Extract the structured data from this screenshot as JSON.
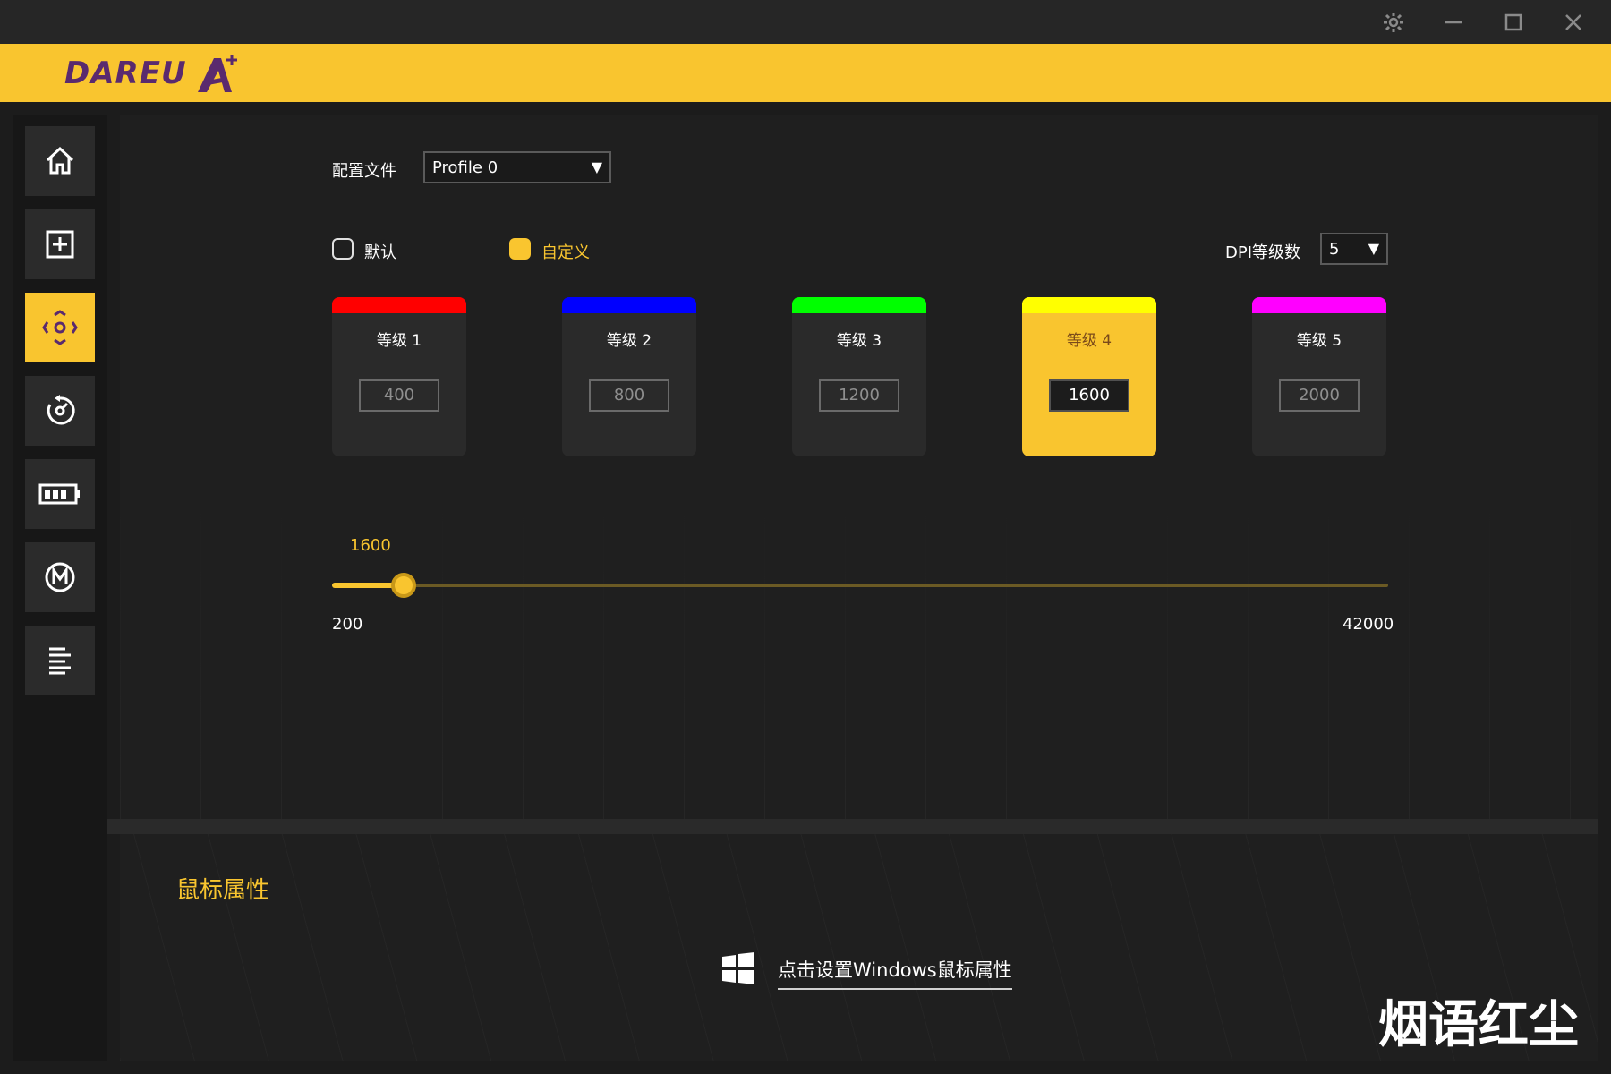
{
  "window": {
    "controls": [
      "settings-icon",
      "minimize-icon",
      "maximize-icon",
      "close-icon"
    ]
  },
  "brand": {
    "logo_text": "DAREU",
    "accent_color": "#f9c52f",
    "logo_color": "#5a2a6e"
  },
  "sidebar": {
    "items": [
      {
        "icon": "home-icon",
        "active": false
      },
      {
        "icon": "plus-square-icon",
        "active": false
      },
      {
        "icon": "dpi-crosshair-icon",
        "active": true
      },
      {
        "icon": "polling-rate-icon",
        "active": false
      },
      {
        "icon": "battery-icon",
        "active": false
      },
      {
        "icon": "macro-m-icon",
        "active": false
      },
      {
        "icon": "list-lines-icon",
        "active": false
      }
    ]
  },
  "profile": {
    "label": "配置文件",
    "value": "Profile 0"
  },
  "mode": {
    "default_label": "默认",
    "custom_label": "自定义",
    "selected": "custom"
  },
  "dpi_levels_select": {
    "label": "DPI等级数",
    "value": "5"
  },
  "dpi_cards": [
    {
      "title": "等级  1",
      "value": "400",
      "color": "#ff0000",
      "active": false
    },
    {
      "title": "等级  2",
      "value": "800",
      "color": "#0000ff",
      "active": false
    },
    {
      "title": "等级  3",
      "value": "1200",
      "color": "#00ff00",
      "active": false
    },
    {
      "title": "等级  4",
      "value": "1600",
      "color": "#ffff00",
      "active": true
    },
    {
      "title": "等级  5",
      "value": "2000",
      "color": "#ff00ff",
      "active": false
    }
  ],
  "slider": {
    "current_label": "1600",
    "min_label": "200",
    "max_label": "42000",
    "min": 200,
    "max": 42000,
    "value": 1600
  },
  "mouse_properties": {
    "title": "鼠标属性",
    "link": "点击设置Windows鼠标属性"
  },
  "watermark": "烟语红尘"
}
